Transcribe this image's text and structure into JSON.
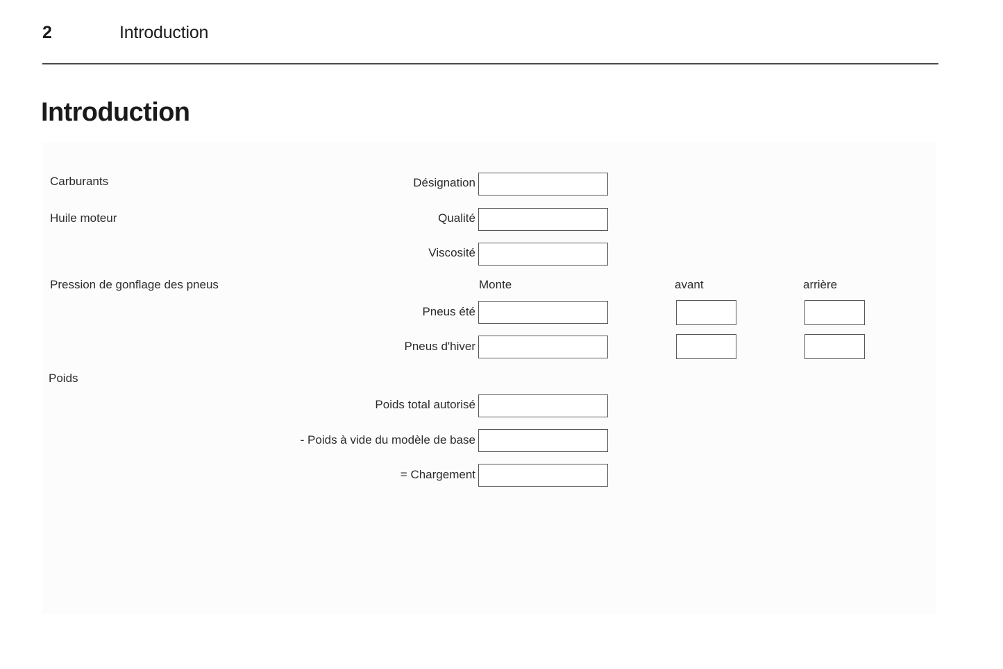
{
  "header": {
    "page_number": "2",
    "section_title": "Introduction"
  },
  "chapter_title": "Introduction",
  "form": {
    "groups": {
      "fuels": "Carburants",
      "engine_oil": "Huile moteur",
      "tyre_pressure": "Pression de gonflage des pneus",
      "weights": "Poids"
    },
    "column_headers": {
      "monte": "Monte",
      "front": "avant",
      "rear": "arrière"
    },
    "labels": {
      "designation": "Désignation",
      "quality": "Qualité",
      "viscosity": "Viscosité",
      "summer_tyres": "Pneus été",
      "winter_tyres": "Pneus d'hiver",
      "gross_weight": "Poids total autorisé",
      "kerb_weight": "- Poids à vide du modèle de base",
      "payload": "= Chargement"
    },
    "values": {
      "designation": "",
      "quality": "",
      "viscosity": "",
      "summer_monte": "",
      "summer_front": "",
      "summer_rear": "",
      "winter_monte": "",
      "winter_front": "",
      "winter_rear": "",
      "gross_weight": "",
      "kerb_weight": "",
      "payload": ""
    }
  },
  "colors": {
    "text": "#1a1a1a",
    "rule": "#4a4a4a",
    "panel_background": "#fcfcfc",
    "box_border": "#585858",
    "box_fill": "#ffffff"
  }
}
